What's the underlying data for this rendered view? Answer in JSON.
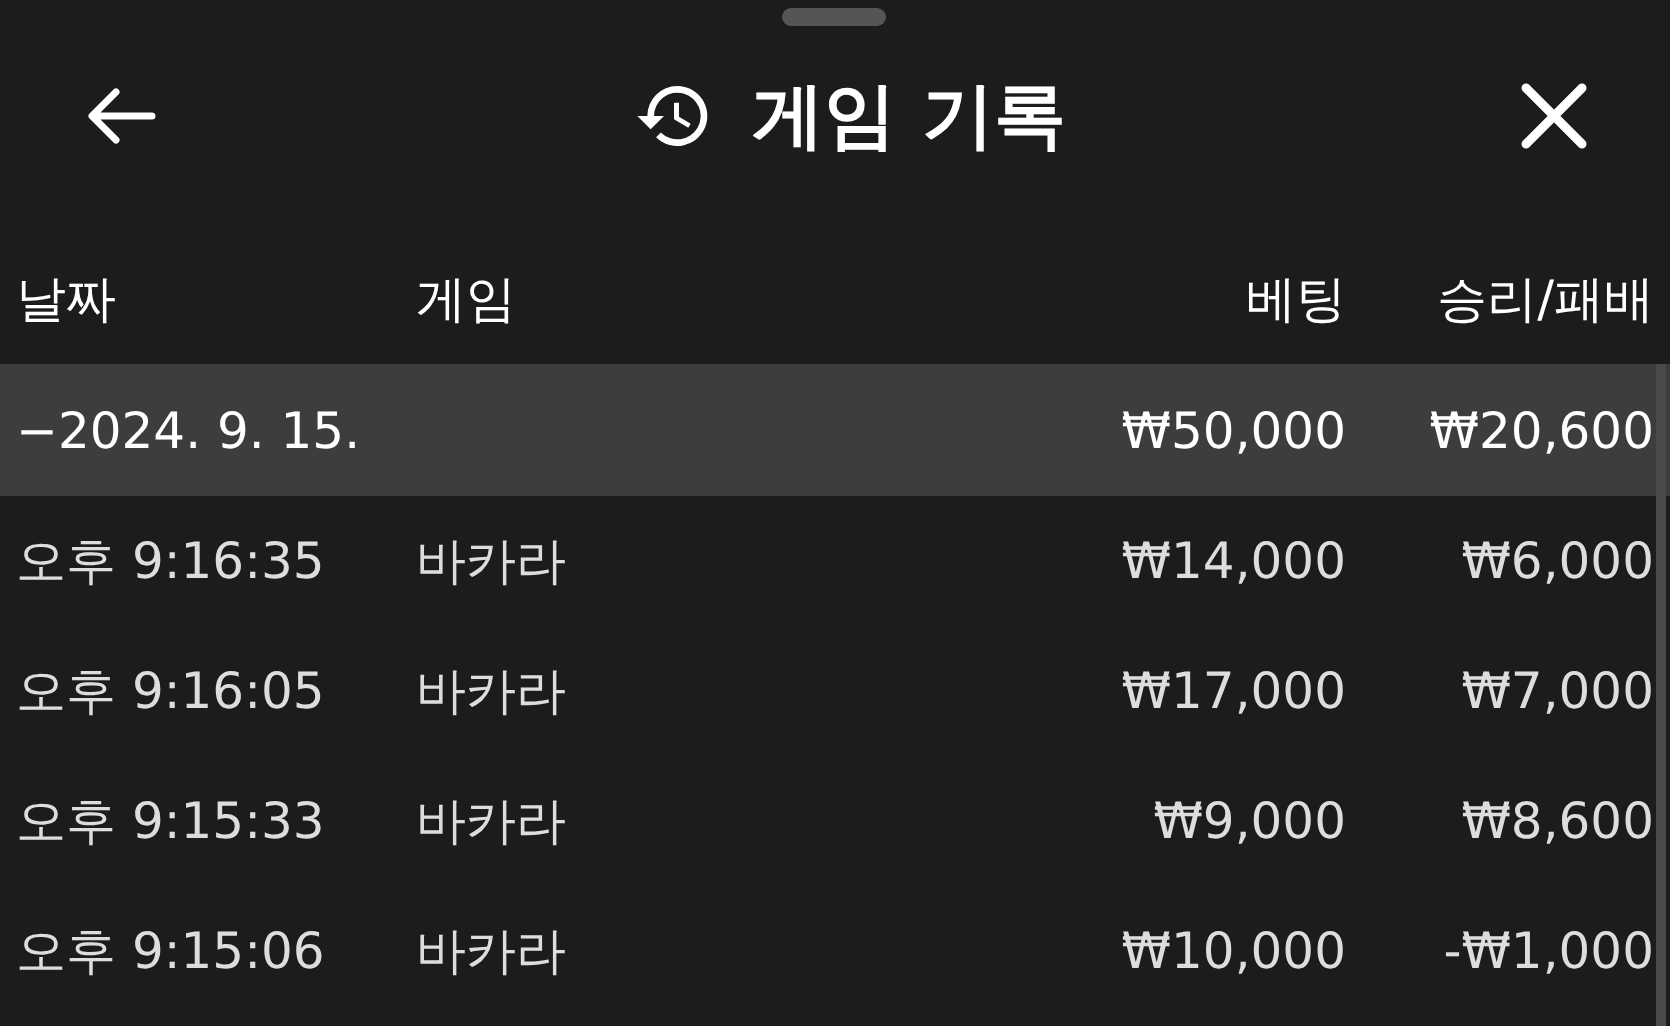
{
  "header": {
    "title": "게임 기록"
  },
  "columns": [
    "날짜",
    "게임",
    "베팅",
    "승리/패배"
  ],
  "groups": [
    {
      "toggle": "−",
      "date": "2024. 9. 15.",
      "bet": "₩50,000",
      "result": "₩20,600",
      "expanded": true,
      "rows": [
        {
          "time": "오후 9:16:35",
          "game": "바카라",
          "bet": "₩14,000",
          "result": "₩6,000"
        },
        {
          "time": "오후 9:16:05",
          "game": "바카라",
          "bet": "₩17,000",
          "result": "₩7,000"
        },
        {
          "time": "오후 9:15:33",
          "game": "바카라",
          "bet": "₩9,000",
          "result": "₩8,600"
        },
        {
          "time": "오후 9:15:06",
          "game": "바카라",
          "bet": "₩10,000",
          "result": "-₩1,000"
        }
      ]
    }
  ]
}
